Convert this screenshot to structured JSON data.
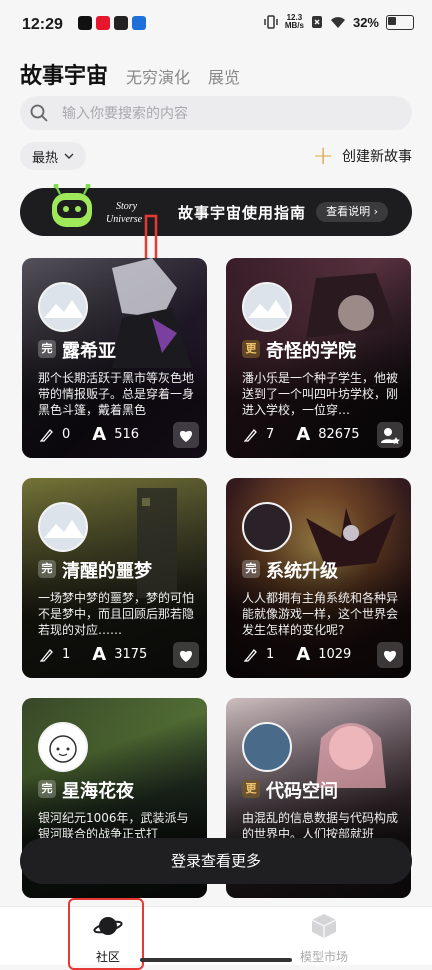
{
  "status_bar": {
    "time": "12:29",
    "net_speed_top": "12.3",
    "net_speed_bottom": "MB/s",
    "battery": "32%"
  },
  "tabs": [
    {
      "label": "故事宇宙"
    },
    {
      "label": "无穷演化"
    },
    {
      "label": "展览"
    }
  ],
  "search": {
    "placeholder": "输入你要搜索的内容"
  },
  "sort": {
    "label": "最热"
  },
  "create": {
    "label": "创建新故事"
  },
  "banner": {
    "brand_line1": "Story",
    "brand_line2": "Universe",
    "title": "故事宇宙使用指南",
    "button": "查看说明"
  },
  "cards": [
    {
      "tag": "完",
      "tag_style": "plain",
      "name": "露希亚",
      "desc": "那个长期活跃于黑市等灰色地带的情报贩子。总是穿着一身黑色斗篷，戴着黑色",
      "likes": "0",
      "reads": "516",
      "icon": "heart-icon"
    },
    {
      "tag": "更",
      "tag_style": "gold",
      "name": "奇怪的学院",
      "desc": "潘小乐是一个种子学生，他被送到了一个叫四叶坊学校，刚进入学校，一位穿…",
      "likes": "7",
      "reads": "82675",
      "icon": "add-user-icon"
    },
    {
      "tag": "完",
      "tag_style": "plain",
      "name": "清醒的噩梦",
      "desc": "一场梦中梦的噩梦，梦的可怕不是梦中，而且回顾后那若隐若现的对应……",
      "likes": "1",
      "reads": "3175",
      "icon": "heart-icon"
    },
    {
      "tag": "完",
      "tag_style": "plain",
      "name": "系统升级",
      "desc": "人人都拥有主角系统和各种异能就像游戏一样，这个世界会发生怎样的变化呢?",
      "likes": "1",
      "reads": "1029",
      "icon": "heart-icon"
    },
    {
      "tag": "完",
      "tag_style": "plain",
      "name": "星海花夜",
      "desc": "银河纪元1006年，武装派与银河联合的战争正式打",
      "likes": "",
      "reads": "",
      "icon": "heart-icon"
    },
    {
      "tag": "更",
      "tag_style": "gold",
      "name": "代码空间",
      "desc": "由混乱的信息数据与代码构成的世界中。人们按部就班",
      "likes": "",
      "reads": "",
      "icon": "add-user-icon"
    }
  ],
  "login_button": {
    "label": "登录查看更多"
  },
  "bottom_nav": [
    {
      "label": "社区",
      "active": true
    },
    {
      "label": "模型市场",
      "active": false
    }
  ],
  "colors": {
    "accent": "#e0a33f",
    "annotation_red": "#e53935",
    "dark": "#1f1f21"
  }
}
